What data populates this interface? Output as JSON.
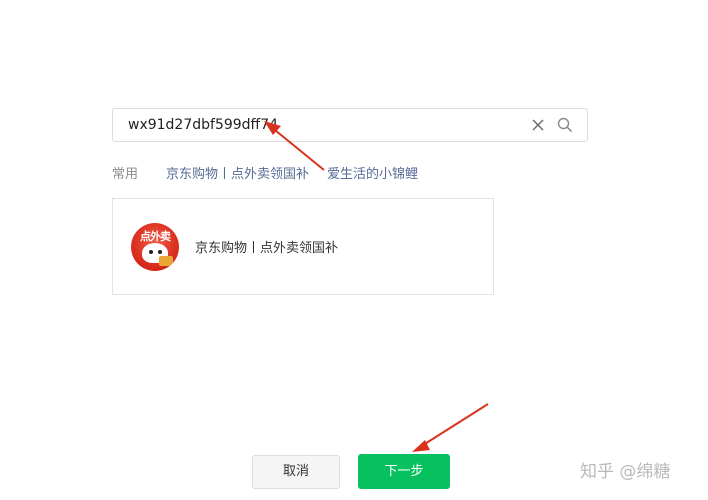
{
  "search": {
    "value": "wx91d27dbf599dff74",
    "clear_icon": "close-icon",
    "search_icon": "search-icon"
  },
  "common": {
    "label": "常用",
    "items": [
      "京东购物丨点外卖领国补",
      "爱生活的小锦鲤"
    ]
  },
  "result": {
    "logo_text": "点外卖",
    "name": "京东购物丨点外卖领国补"
  },
  "buttons": {
    "cancel": "取消",
    "next": "下一步"
  },
  "annotations": {
    "arrow_color": "#d9321f"
  },
  "watermark": "知乎 @绵糖",
  "colors": {
    "primary_green": "#07c160",
    "link_blue": "#576b95"
  }
}
